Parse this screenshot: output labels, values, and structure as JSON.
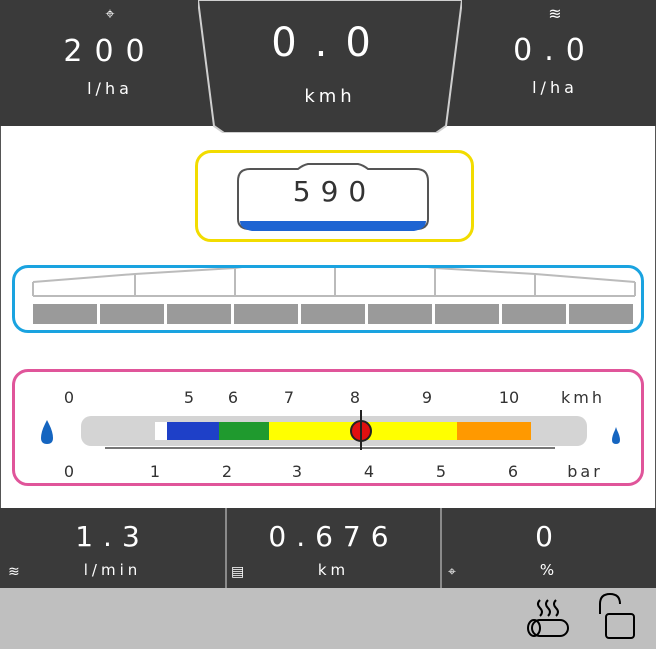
{
  "top": {
    "left": {
      "value": "200",
      "unit": "l/ha",
      "icon": "target-icon"
    },
    "center": {
      "value": "0.0",
      "unit": "kmh"
    },
    "right": {
      "value": "0.0",
      "unit": "l/ha",
      "icon": "flow-icon"
    }
  },
  "tank": {
    "value": "590",
    "level": 0.1
  },
  "speed_scale": {
    "top_ticks": [
      "0",
      "5",
      "6",
      "7",
      "8",
      "9",
      "10"
    ],
    "top_unit": "kmh",
    "bottom_ticks": [
      "0",
      "1",
      "2",
      "3",
      "4",
      "5",
      "6"
    ],
    "bottom_unit": "bar",
    "segments": [
      {
        "color": "#ffffff"
      },
      {
        "color": "#1e40c8"
      },
      {
        "color": "#1f9a2e"
      },
      {
        "color": "#ffff00"
      },
      {
        "color": "#ffff00"
      },
      {
        "color": "#ff9900"
      }
    ]
  },
  "bottom": {
    "left": {
      "value": "1.3",
      "unit": "l/min",
      "icon": "flow-icon"
    },
    "center": {
      "value": "0.676",
      "unit": "km",
      "icon": "clipboard-icon"
    },
    "right": {
      "value": "0",
      "unit": "%",
      "icon": "target-icon"
    }
  },
  "colors": {
    "tank_highlight": "#f2dc00",
    "boom_highlight": "#1aa3e0",
    "speed_highlight": "#e0559a",
    "drop": "#1565c0"
  }
}
